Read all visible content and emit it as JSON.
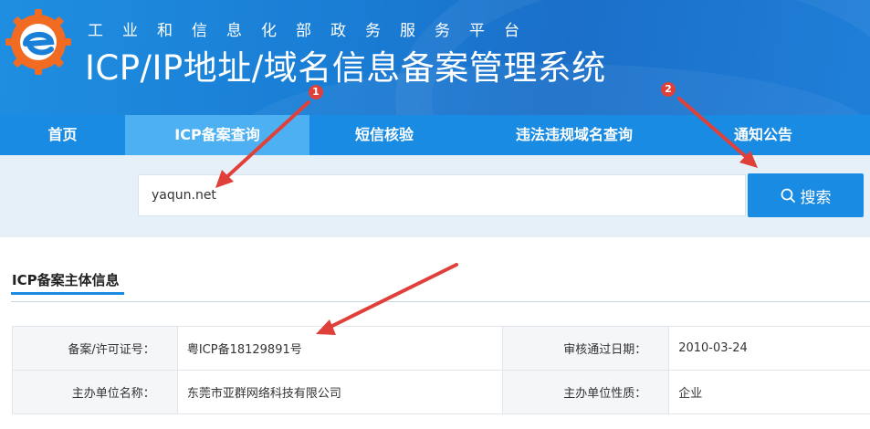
{
  "header": {
    "subtitle": "工业和信息化部政务服务平台",
    "title": "ICP/IP地址/域名信息备案管理系统",
    "logo_icon": "e-gear-logo-icon"
  },
  "nav": {
    "items": [
      {
        "label": "首页"
      },
      {
        "label": "ICP备案查询"
      },
      {
        "label": "短信核验"
      },
      {
        "label": "违法违规域名查询"
      },
      {
        "label": "通知公告"
      }
    ],
    "active_index": 1
  },
  "search": {
    "value": "yaqun.net",
    "button_label": "搜索",
    "button_icon": "search-icon"
  },
  "section": {
    "title": "ICP备案主体信息"
  },
  "info_table": [
    {
      "label1": "备案/许可证号：",
      "value1": "粤ICP备18129891号",
      "label2": "审核通过日期：",
      "value2": "2010-03-24"
    },
    {
      "label1": "主办单位名称：",
      "value1": "东莞市亚群网络科技有限公司",
      "label2": "主办单位性质：",
      "value2": "企业"
    }
  ],
  "annotations": {
    "badge1": "1",
    "badge2": "2"
  },
  "colors": {
    "primary": "#1a8be3",
    "nav_active": "#4cb0f2",
    "annotation": "#e0403a"
  }
}
